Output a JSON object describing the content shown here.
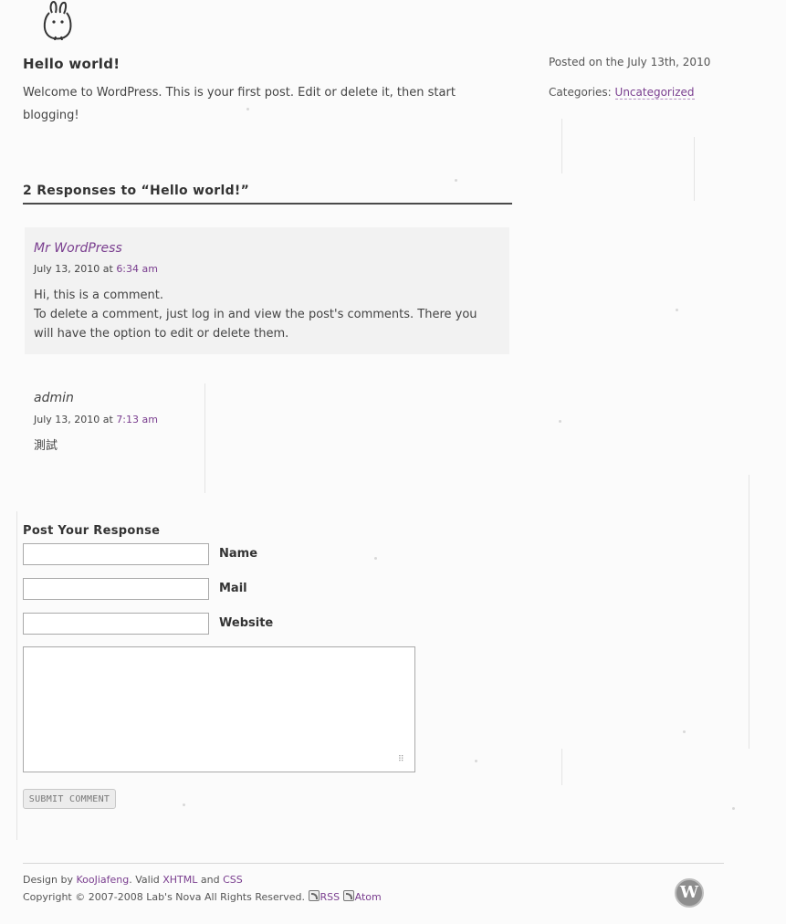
{
  "post": {
    "title": "Hello world!",
    "body": "Welcome to WordPress. This is your first post. Edit or delete it, then start blogging!"
  },
  "meta": {
    "posted_on": "Posted on the July 13th, 2010",
    "categories_label": "Categories: ",
    "category": "Uncategorized"
  },
  "comments": {
    "heading": "2 Responses to “Hello world!”",
    "items": [
      {
        "author": "Mr WordPress",
        "date_prefix": "July 13, 2010 at ",
        "time": "6:34 am",
        "text_line1": "Hi, this is a comment.",
        "text_line2": "To delete a comment, just log in and view the post's comments. There you will have the option to edit or delete them."
      },
      {
        "author": "admin",
        "date_prefix": "July 13, 2010 at ",
        "time": "7:13 am",
        "text_line1": "測試"
      }
    ]
  },
  "respond": {
    "heading": "Post Your Response",
    "name_label": "Name",
    "mail_label": "Mail",
    "website_label": "Website",
    "name_value": "",
    "mail_value": "",
    "website_value": "",
    "comment_value": "",
    "submit_label": "SUBMIT COMMENT"
  },
  "footer": {
    "design_by": "Design by ",
    "designer": "KooJiafeng",
    "valid": ". Valid ",
    "xhtml": "XHTML",
    "and": " and ",
    "css": "CSS",
    "copyright": "Copyright © 2007-2008 Lab's Nova All Rights Reserved. ",
    "rss": "RSS",
    "atom": "Atom"
  },
  "colors": {
    "link": "#7a3e8f",
    "comment_bg": "#f2f2f2",
    "page_bg": "#fbfbfb"
  }
}
